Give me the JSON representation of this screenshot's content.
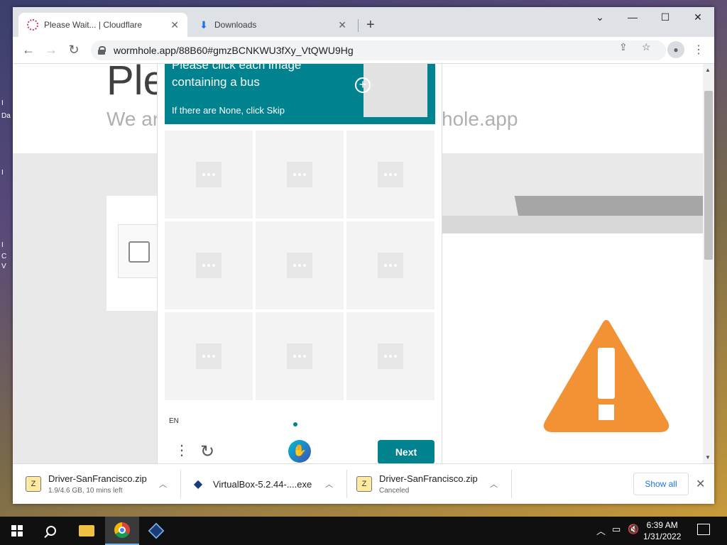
{
  "desktop": {
    "fragments": [
      "I",
      "Da",
      "I",
      "I",
      "C",
      "V"
    ]
  },
  "browser": {
    "tabs": [
      {
        "title": "Please Wait... | Cloudflare",
        "icon": "cloudflare-favicon"
      },
      {
        "title": "Downloads",
        "icon": "download-icon"
      }
    ],
    "new_tab": "+",
    "window_controls": {
      "tab_search": "⌄",
      "minimize": "—",
      "maximize": "☐",
      "close": "✕"
    },
    "url": "wormhole.app/88B60#gmzBCNKWU3fXy_VtQWU9Hg"
  },
  "page": {
    "heading": "Ple",
    "subheading": "We ar",
    "subheading_right": "hole.app"
  },
  "captcha": {
    "prompt": "Please click each image containing a bus",
    "note": "If there are None, click Skip",
    "language": "EN",
    "next_label": "Next",
    "grid_cells": 9
  },
  "downloads": [
    {
      "name": "Driver-SanFrancisco.zip",
      "status": "1.9/4.6 GB, 10 mins left",
      "icon": "zip-icon"
    },
    {
      "name": "VirtualBox-5.2.44-....exe",
      "status": "",
      "icon": "virtualbox-icon"
    },
    {
      "name": "Driver-SanFrancisco.zip",
      "status": "Canceled",
      "icon": "zip-icon"
    }
  ],
  "downloads_bar": {
    "show_all": "Show all"
  },
  "taskbar": {
    "time": "6:39 AM",
    "date": "1/31/2022"
  },
  "colors": {
    "captcha_accent": "#00838f",
    "warning": "#f39234"
  }
}
